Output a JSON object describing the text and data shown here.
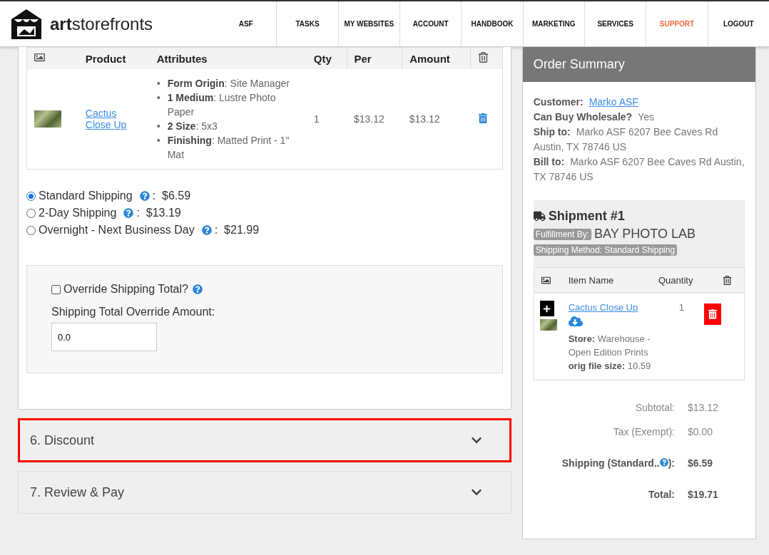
{
  "brand": {
    "name_bold": "art",
    "name_rest": "storefronts"
  },
  "nav": [
    {
      "label": "ASF",
      "highlight": false
    },
    {
      "label": "TASKS",
      "highlight": false
    },
    {
      "label": "MY WEBSITES",
      "highlight": false
    },
    {
      "label": "ACCOUNT",
      "highlight": false
    },
    {
      "label": "HANDBOOK",
      "highlight": false
    },
    {
      "label": "MARKETING",
      "highlight": false
    },
    {
      "label": "SERVICES",
      "highlight": false
    },
    {
      "label": "SUPPORT",
      "highlight": true
    },
    {
      "label": "LOGOUT",
      "highlight": false
    }
  ],
  "cart_table": {
    "columns": [
      "Product",
      "Attributes",
      "Qty",
      "Per",
      "Amount"
    ],
    "rows": [
      {
        "product": "Cactus Close Up",
        "attributes": [
          {
            "marker": "•",
            "text": "**Form Origin**: Site Manager"
          },
          {
            "marker": "•",
            "text": "**1 Medium**: Lustre Photo Paper"
          },
          {
            "marker": "•",
            "text": "**2 Size**: 5x3"
          },
          {
            "marker": "•",
            "text": "**Finishing**: Matted Print - 1\" Mat"
          }
        ],
        "qty": "1",
        "per": "$13.12",
        "amount": "$13.12"
      }
    ]
  },
  "shipping_options": [
    {
      "label": "Standard Shipping",
      "price": ":  $6.59",
      "selected": true
    },
    {
      "label": "2-Day Shipping",
      "price": ":  $13.19",
      "selected": false
    },
    {
      "label": "Overnight - Next Business Day",
      "price": ":  $21.99",
      "selected": false
    }
  ],
  "override": {
    "label": "Override Shipping Total?",
    "checked": false,
    "amount_label": "Shipping Total Override Amount:",
    "amount_value": "0.0"
  },
  "sections": [
    {
      "title": "6. Discount",
      "highlighted": true
    },
    {
      "title": "7. Review & Pay",
      "highlighted": false
    }
  ],
  "summary": {
    "title": "Order Summary",
    "info": [
      {
        "label": "Customer:",
        "value": "Marko ASF",
        "kind": "link"
      },
      {
        "label": "Can Buy Wholesale?",
        "value": "Yes",
        "kind": "text"
      },
      {
        "label": "Ship to:",
        "value": "Marko ASF 6207 Bee Caves Rd Austin, TX 78746 US",
        "kind": "text"
      },
      {
        "label": "Bill to:",
        "value": "Marko ASF 6207 Bee Caves Rd Austin, TX 78746 US",
        "kind": "text"
      }
    ],
    "shipment": {
      "title": "Shipment #1",
      "fulfillment_label": "Fulfillment By:",
      "fulfillment_value": "BAY PHOTO LAB",
      "method": "Shipping Method: Standard Shipping",
      "columns": [
        "Item Name",
        "Quantity"
      ],
      "items": [
        {
          "name": "Cactus Close Up",
          "quantity": "1",
          "store_label": "Store:",
          "store": "Warehouse - Open Edition Prints",
          "size_label": "orig file size:",
          "size": "10.59"
        }
      ]
    },
    "totals": [
      {
        "label": "Subtotal:",
        "value": "$13.12",
        "bold": false,
        "help": false
      },
      {
        "label": "Tax (Exempt):",
        "value": "$0.00",
        "bold": false,
        "help": false
      },
      {
        "label": "Shipping (Standard..",
        "label_end": "):",
        "value": "$6.59",
        "bold": true,
        "help": true
      },
      {
        "label": "Total:",
        "value": "$19.71",
        "bold": true,
        "help": false
      }
    ]
  }
}
